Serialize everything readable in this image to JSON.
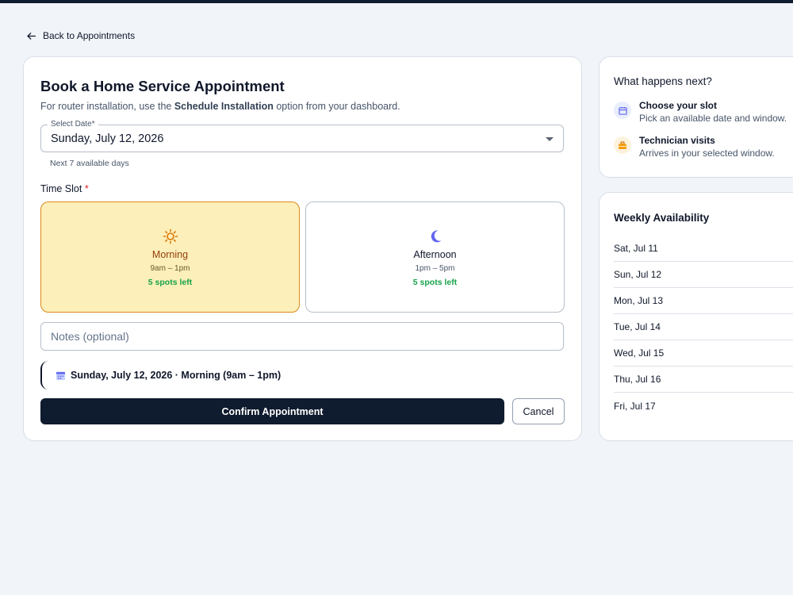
{
  "nav": {
    "back_label": "Back to Appointments"
  },
  "booking": {
    "title": "Book a Home Service Appointment",
    "subtitle_pre": "For router installation, use the ",
    "subtitle_bold": "Schedule Installation",
    "subtitle_post": " option from your dashboard.",
    "date_field_label": "Select Date",
    "date_field_required": "*",
    "date_value": "Sunday, July 12, 2026",
    "date_helper": "Next 7 available days",
    "slot_label": "Time Slot",
    "slot_required": "*",
    "slots": [
      {
        "name": "Morning",
        "hours": "9am – 1pm",
        "spots": "5 spots left",
        "icon": "sun-icon",
        "selected": true
      },
      {
        "name": "Afternoon",
        "hours": "1pm – 5pm",
        "spots": "5 spots left",
        "icon": "moon-icon",
        "selected": false
      }
    ],
    "notes_placeholder": "Notes (optional)",
    "summary_text": "Sunday, July 12, 2026 · Morning (9am – 1pm)",
    "confirm_label": "Confirm Appointment",
    "cancel_label": "Cancel"
  },
  "next_steps": {
    "title": "What happens next?",
    "steps": [
      {
        "title": "Choose your slot",
        "desc": "Pick an available date and window.",
        "icon": "calendar-icon"
      },
      {
        "title": "Technician visits",
        "desc": "Arrives in your selected window.",
        "icon": "toolbox-icon"
      }
    ]
  },
  "weekly": {
    "title": "Weekly Availability",
    "days": [
      "Sat, Jul 11",
      "Sun, Jul 12",
      "Mon, Jul 13",
      "Tue, Jul 14",
      "Wed, Jul 15",
      "Thu, Jul 16",
      "Fri, Jul 17"
    ]
  },
  "colors": {
    "accent_dark": "#0f1b2e",
    "selected_bg": "#fdefb9",
    "selected_border": "#d98a1c",
    "spots_green": "#16a34a",
    "required_red": "#dc2626"
  }
}
